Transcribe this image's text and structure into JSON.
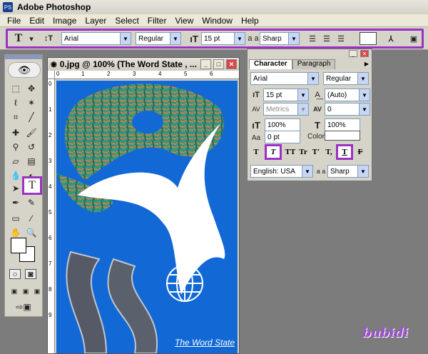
{
  "app": {
    "title": "Adobe Photoshop",
    "logo": "PS"
  },
  "menu": [
    "File",
    "Edit",
    "Image",
    "Layer",
    "Select",
    "Filter",
    "View",
    "Window",
    "Help"
  ],
  "options": {
    "tool_icon": "T",
    "font_family": "Arial",
    "font_style": "Regular",
    "font_size": "15 pt",
    "aa_label": "a a",
    "anti_alias": "Sharp"
  },
  "document": {
    "title": "0.jpg @ 100% (The Word State , ...",
    "caption": "The Word State",
    "ruler_top": [
      "0",
      "1",
      "2",
      "3",
      "4",
      "5",
      "6"
    ],
    "ruler_left": [
      "0",
      "1",
      "2",
      "3",
      "4",
      "5",
      "6",
      "7",
      "8",
      "9"
    ]
  },
  "character_palette": {
    "tabs": [
      "Character",
      "Paragraph"
    ],
    "font_family": "Arial",
    "font_style": "Regular",
    "size": "15 pt",
    "leading": "(Auto)",
    "kerning": "Metrics",
    "tracking": "0",
    "vscale": "100%",
    "hscale": "100%",
    "baseline": "0 pt",
    "color_label": "Color:",
    "style_buttons": [
      "T",
      "T",
      "TT",
      "Tr",
      "T'",
      "T,",
      "T",
      "F"
    ],
    "language": "English: USA",
    "aa_label": "a a",
    "anti_alias": "Sharp"
  },
  "watermark": "bubidi",
  "colors": {
    "accent": "#9b32c4",
    "canvas": "#1269d6"
  }
}
